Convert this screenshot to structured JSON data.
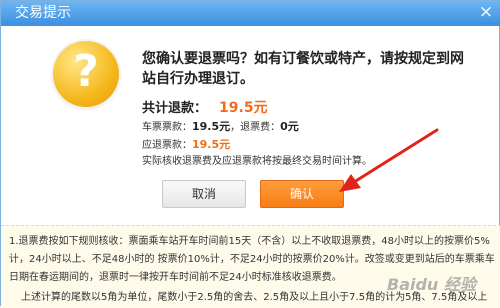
{
  "dialog": {
    "title": "交易提示",
    "close_glyph": "×",
    "question_glyph": "?",
    "message": "您确认要退票吗？如有订餐饮或特产，请按规定到网站自行办理退订。",
    "total_label": "共计退款：",
    "total_amount": "19.5元",
    "ticket_price_label": "车票票款：",
    "ticket_price": "19.5元",
    "fee_label": "，退票费：",
    "fee": "0元",
    "refund_label": "应退票款：",
    "refund": "19.5元",
    "note": "实际核收退票费及应退票款将按最终交易时间计算。",
    "cancel_label": "取消",
    "confirm_label": "确认"
  },
  "notes": {
    "line1": "1.退票费按如下规则核收：票面乘车站开车时间前15天（不含）以上不收取退票费，48小时以上的按票价5%",
    "line2": "计，24小时以上、不足48小时的 按票价10%计，不足24小时的按票价20%计。改签或变更到站后的车票乘车",
    "line3": "日期在春运期间的，退票时一律按开车时间前不足24小时标准核收退票费。",
    "line4": "上述计算的尾数以5角为单位，尾数小于2.5角的舍去、2.5角及以上且小于7.5角的计为5角、7.5角及以上"
  },
  "watermark": "Baidu 经验"
}
